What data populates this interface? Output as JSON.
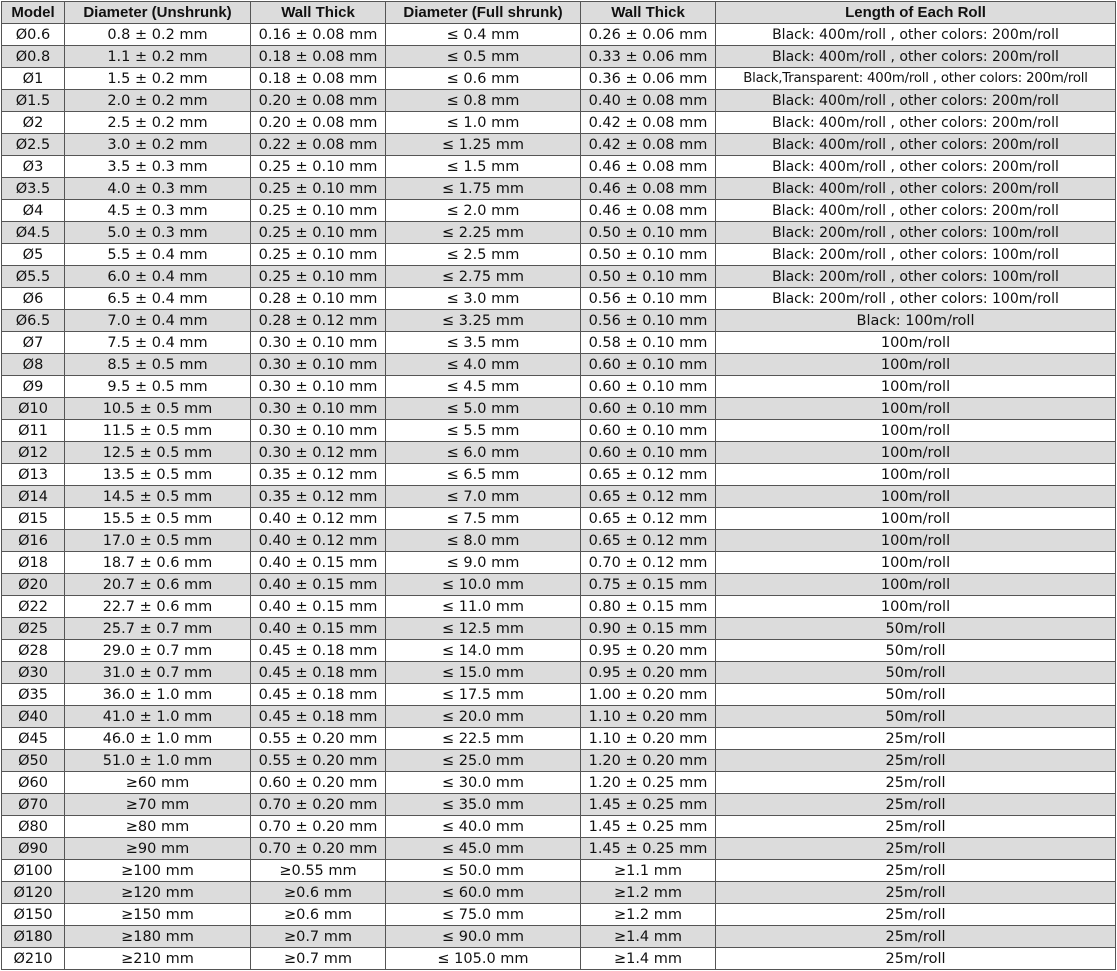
{
  "headers": [
    "Model",
    "Diameter (Unshrunk)",
    "Wall Thick",
    "Diameter (Full shrunk)",
    "Wall Thick",
    "Length of Each Roll"
  ],
  "rows": [
    [
      "Ø0.6",
      "0.8 ± 0.2 mm",
      "0.16 ± 0.08 mm",
      "≤ 0.4 mm",
      "0.26 ± 0.06 mm",
      "Black: 400m/roll , other colors: 200m/roll"
    ],
    [
      "Ø0.8",
      "1.1 ± 0.2 mm",
      "0.18 ± 0.08 mm",
      "≤ 0.5 mm",
      "0.33 ± 0.06 mm",
      "Black: 400m/roll , other colors: 200m/roll"
    ],
    [
      "Ø1",
      "1.5 ± 0.2 mm",
      "0.18 ± 0.08 mm",
      "≤ 0.6 mm",
      "0.36 ± 0.06 mm",
      "Black,Transparent: 400m/roll , other colors: 200m/roll"
    ],
    [
      "Ø1.5",
      "2.0 ± 0.2 mm",
      "0.20 ± 0.08 mm",
      "≤ 0.8 mm",
      "0.40 ± 0.08 mm",
      "Black: 400m/roll , other colors: 200m/roll"
    ],
    [
      "Ø2",
      "2.5 ± 0.2 mm",
      "0.20 ± 0.08 mm",
      "≤ 1.0 mm",
      "0.42 ± 0.08 mm",
      "Black: 400m/roll , other colors: 200m/roll"
    ],
    [
      "Ø2.5",
      "3.0 ± 0.2 mm",
      "0.22 ± 0.08 mm",
      "≤ 1.25 mm",
      "0.42 ± 0.08 mm",
      "Black: 400m/roll , other colors: 200m/roll"
    ],
    [
      "Ø3",
      "3.5 ± 0.3 mm",
      "0.25 ± 0.10 mm",
      "≤ 1.5 mm",
      "0.46 ± 0.08 mm",
      "Black: 400m/roll , other colors: 200m/roll"
    ],
    [
      "Ø3.5",
      "4.0 ± 0.3 mm",
      "0.25 ± 0.10 mm",
      "≤ 1.75 mm",
      "0.46 ± 0.08 mm",
      "Black: 400m/roll , other colors: 200m/roll"
    ],
    [
      "Ø4",
      "4.5 ± 0.3 mm",
      "0.25 ± 0.10 mm",
      "≤ 2.0 mm",
      "0.46 ± 0.08 mm",
      "Black: 400m/roll , other colors: 200m/roll"
    ],
    [
      "Ø4.5",
      "5.0 ± 0.3 mm",
      "0.25 ± 0.10 mm",
      "≤ 2.25 mm",
      "0.50 ± 0.10 mm",
      "Black: 200m/roll , other colors: 100m/roll"
    ],
    [
      "Ø5",
      "5.5 ± 0.4 mm",
      "0.25 ± 0.10 mm",
      "≤ 2.5 mm",
      "0.50 ± 0.10 mm",
      "Black: 200m/roll , other colors: 100m/roll"
    ],
    [
      "Ø5.5",
      "6.0 ± 0.4 mm",
      "0.25 ± 0.10 mm",
      "≤ 2.75 mm",
      "0.50 ± 0.10 mm",
      "Black: 200m/roll , other colors: 100m/roll"
    ],
    [
      "Ø6",
      "6.5 ± 0.4 mm",
      "0.28 ± 0.10 mm",
      "≤ 3.0 mm",
      "0.56 ± 0.10 mm",
      "Black: 200m/roll , other colors: 100m/roll"
    ],
    [
      "Ø6.5",
      "7.0 ± 0.4 mm",
      "0.28 ± 0.12 mm",
      "≤ 3.25 mm",
      "0.56 ± 0.10 mm",
      "Black: 100m/roll"
    ],
    [
      "Ø7",
      "7.5 ± 0.4 mm",
      "0.30 ± 0.10 mm",
      "≤ 3.5 mm",
      "0.58 ± 0.10 mm",
      "100m/roll"
    ],
    [
      "Ø8",
      "8.5 ± 0.5 mm",
      "0.30 ± 0.10 mm",
      "≤ 4.0 mm",
      "0.60 ± 0.10 mm",
      "100m/roll"
    ],
    [
      "Ø9",
      "9.5 ± 0.5 mm",
      "0.30 ± 0.10 mm",
      "≤ 4.5 mm",
      "0.60 ± 0.10 mm",
      "100m/roll"
    ],
    [
      "Ø10",
      "10.5 ± 0.5 mm",
      "0.30 ± 0.10 mm",
      "≤ 5.0 mm",
      "0.60 ± 0.10 mm",
      "100m/roll"
    ],
    [
      "Ø11",
      "11.5 ± 0.5 mm",
      "0.30 ± 0.10 mm",
      "≤ 5.5 mm",
      "0.60 ± 0.10 mm",
      "100m/roll"
    ],
    [
      "Ø12",
      "12.5 ± 0.5 mm",
      "0.30 ± 0.12 mm",
      "≤ 6.0 mm",
      "0.60 ± 0.10 mm",
      "100m/roll"
    ],
    [
      "Ø13",
      "13.5 ± 0.5 mm",
      "0.35 ± 0.12 mm",
      "≤ 6.5 mm",
      "0.65 ± 0.12 mm",
      "100m/roll"
    ],
    [
      "Ø14",
      "14.5 ± 0.5 mm",
      "0.35 ± 0.12 mm",
      "≤ 7.0 mm",
      "0.65 ± 0.12 mm",
      "100m/roll"
    ],
    [
      "Ø15",
      "15.5 ± 0.5 mm",
      "0.40 ± 0.12 mm",
      "≤ 7.5 mm",
      "0.65 ± 0.12 mm",
      "100m/roll"
    ],
    [
      "Ø16",
      "17.0 ± 0.5 mm",
      "0.40 ± 0.12 mm",
      "≤ 8.0 mm",
      "0.65 ± 0.12 mm",
      "100m/roll"
    ],
    [
      "Ø18",
      "18.7 ± 0.6 mm",
      "0.40 ± 0.15 mm",
      "≤ 9.0 mm",
      "0.70 ± 0.12 mm",
      "100m/roll"
    ],
    [
      "Ø20",
      "20.7 ± 0.6 mm",
      "0.40 ± 0.15 mm",
      "≤ 10.0 mm",
      "0.75 ± 0.15 mm",
      "100m/roll"
    ],
    [
      "Ø22",
      "22.7 ± 0.6 mm",
      "0.40 ± 0.15 mm",
      "≤ 11.0 mm",
      "0.80 ± 0.15 mm",
      "100m/roll"
    ],
    [
      "Ø25",
      "25.7 ± 0.7 mm",
      "0.40 ± 0.15 mm",
      "≤ 12.5 mm",
      "0.90 ± 0.15 mm",
      "50m/roll"
    ],
    [
      "Ø28",
      "29.0 ± 0.7 mm",
      "0.45 ± 0.18 mm",
      "≤ 14.0 mm",
      "0.95 ± 0.20 mm",
      "50m/roll"
    ],
    [
      "Ø30",
      "31.0 ± 0.7 mm",
      "0.45 ± 0.18 mm",
      "≤ 15.0 mm",
      "0.95 ± 0.20 mm",
      "50m/roll"
    ],
    [
      "Ø35",
      "36.0 ± 1.0 mm",
      "0.45 ± 0.18 mm",
      "≤ 17.5 mm",
      "1.00 ± 0.20 mm",
      "50m/roll"
    ],
    [
      "Ø40",
      "41.0 ± 1.0 mm",
      "0.45 ± 0.18 mm",
      "≤ 20.0 mm",
      "1.10 ± 0.20 mm",
      "50m/roll"
    ],
    [
      "Ø45",
      "46.0 ± 1.0 mm",
      "0.55 ± 0.20 mm",
      "≤ 22.5 mm",
      "1.10 ± 0.20 mm",
      "25m/roll"
    ],
    [
      "Ø50",
      "51.0 ± 1.0 mm",
      "0.55 ± 0.20 mm",
      "≤ 25.0 mm",
      "1.20 ± 0.20 mm",
      "25m/roll"
    ],
    [
      "Ø60",
      "≥60 mm",
      "0.60 ± 0.20 mm",
      "≤ 30.0 mm",
      "1.20 ± 0.25 mm",
      "25m/roll"
    ],
    [
      "Ø70",
      "≥70 mm",
      "0.70 ± 0.20 mm",
      "≤ 35.0 mm",
      "1.45 ± 0.25 mm",
      "25m/roll"
    ],
    [
      "Ø80",
      "≥80 mm",
      "0.70 ± 0.20 mm",
      "≤ 40.0 mm",
      "1.45 ± 0.25 mm",
      "25m/roll"
    ],
    [
      "Ø90",
      "≥90 mm",
      "0.70 ± 0.20 mm",
      "≤ 45.0 mm",
      "1.45 ± 0.25 mm",
      "25m/roll"
    ],
    [
      "Ø100",
      "≥100 mm",
      "≥0.55 mm",
      "≤ 50.0 mm",
      "≥1.1 mm",
      "25m/roll"
    ],
    [
      "Ø120",
      "≥120 mm",
      "≥0.6 mm",
      "≤ 60.0 mm",
      "≥1.2 mm",
      "25m/roll"
    ],
    [
      "Ø150",
      "≥150 mm",
      "≥0.6 mm",
      "≤ 75.0 mm",
      "≥1.2 mm",
      "25m/roll"
    ],
    [
      "Ø180",
      "≥180 mm",
      "≥0.7 mm",
      "≤ 90.0 mm",
      "≥1.4 mm",
      "25m/roll"
    ],
    [
      "Ø210",
      "≥210 mm",
      "≥0.7 mm",
      "≤ 105.0 mm",
      "≥1.4 mm",
      "25m/roll"
    ]
  ],
  "colors": {
    "header_bg": "#dcdcdc",
    "row_alt_bg": "#dcdcdc",
    "row_bg": "#ffffff",
    "border": "#555555",
    "text": "#111111"
  }
}
